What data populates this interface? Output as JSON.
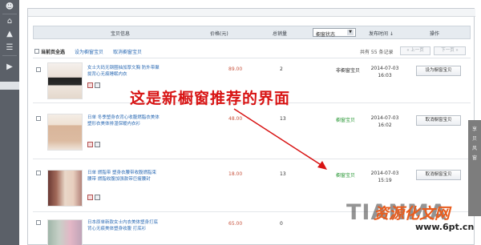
{
  "table": {
    "headers": {
      "product": "宝贝信息",
      "price": "价格(元)",
      "qty": "总销量",
      "status_select": "橱窗状态",
      "time": "发布时间 ↓",
      "action": "操作"
    }
  },
  "toolbar": {
    "select_all": "当前页全选",
    "set_window": "设为橱窗宝贝",
    "cancel_window": "取消橱窗宝贝",
    "count_text": "共有 55 条记录",
    "prev": "« 上一页",
    "next": "下一页 »"
  },
  "rows": [
    {
      "title": "女士大码无钢圈抽加厚文胸 防外带聚拢背心无痕睡眠内衣",
      "price": "89.00",
      "qty": "2",
      "status": "非橱窗宝贝",
      "date": "2014-07-03",
      "time": "16:03",
      "action": "设为橱窗宝贝"
    },
    {
      "title": "日单 冬季塑身衣背心收腹燃脂衣美体塑形衣美体排湿保暖内衣衫",
      "price": "48.00",
      "qty": "13",
      "status": "橱窗宝贝",
      "date": "2014-07-03",
      "time": "16:02",
      "action": "取消橱窗宝贝"
    },
    {
      "title": "日单 燃脂带 塑身衣腰带收腹燃脂束腰带 燃脂收腹加强款带巨瘦腰封",
      "price": "18.00",
      "qty": "13",
      "status": "橱窗宝贝",
      "date": "2014-07-03",
      "time": "15:19",
      "action": "取消橱窗宝贝"
    },
    {
      "title": "日本原单新款女士内衣美体塑身打底背心无痕美体塑身收腹 打底衫",
      "price": "65.00",
      "qty": "0",
      "status": "",
      "date": "",
      "time": "",
      "action": ""
    }
  ],
  "annotation": "这是新橱窗推荐的界面",
  "watermark": {
    "brand": "TIANMA",
    "site": "资源化文网",
    "url": "www.6pt.cn"
  },
  "right_chars": "享 贝 风 窗",
  "colors": {
    "sidebar": "#5b6068",
    "link": "#2f6db5",
    "price": "#c8543f",
    "in_window_status": "#2f9a3b",
    "annotation": "#d81414"
  }
}
